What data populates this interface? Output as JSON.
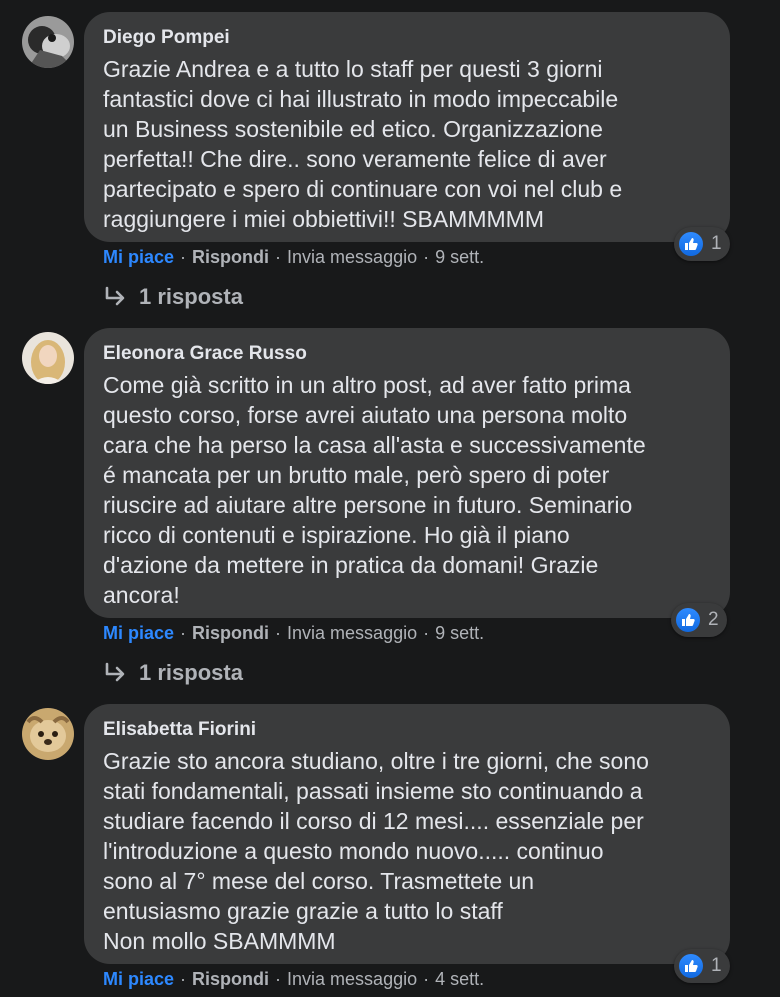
{
  "comments": [
    {
      "author": "Diego Pompei",
      "text": "Grazie Andrea e a tutto lo staff per questi 3 giorni\nfantastici dove ci hai illustrato in modo impeccabile\nun Business sostenibile ed etico. Organizzazione\nperfetta!! Che dire.. sono veramente felice di aver\npartecipato e spero di continuare con voi nel club e\nraggiungere i miei obbiettivi!! SBAMMMMM",
      "reaction_count": "1",
      "actions": {
        "like": "Mi piace",
        "reply": "Rispondi",
        "message": "Invia messaggio",
        "time": "9 sett."
      },
      "replies_label": "1 risposta"
    },
    {
      "author": "Eleonora Grace Russo",
      "text": "Come già scritto in un altro post, ad aver fatto prima\nquesto corso, forse avrei aiutato una persona molto\ncara che ha perso la casa all'asta e successivamente\né mancata per un brutto male, però spero di poter\nriuscire ad aiutare altre persone in futuro. Seminario\nricco di contenuti e ispirazione. Ho già il piano\nd'azione da mettere in pratica da domani! Grazie\nancora!",
      "reaction_count": "2",
      "actions": {
        "like": "Mi piace",
        "reply": "Rispondi",
        "message": "Invia messaggio",
        "time": "9 sett."
      },
      "replies_label": "1 risposta"
    },
    {
      "author": "Elisabetta Fiorini",
      "text": "Grazie sto ancora studiano, oltre i tre giorni, che sono\nstati fondamentali, passati insieme sto continuando a\nstudiare facendo il corso di 12 mesi.... essenziale per\nl'introduzione a questo mondo nuovo..... continuo\nsono al 7° mese del corso. Trasmettete un\nentusiasmo grazie grazie a tutto lo staff\nNon mollo SBAMMMM",
      "reaction_count": "1",
      "actions": {
        "like": "Mi piace",
        "reply": "Rispondi",
        "message": "Invia messaggio",
        "time": "4 sett."
      }
    }
  ],
  "icons": {
    "like": "thumbs-up-icon",
    "reply_arrow": "reply-arrow-icon"
  },
  "colors": {
    "background": "#18191a",
    "bubble": "#3a3b3c",
    "text": "#e4e6eb",
    "secondary": "#b0b3b8",
    "accent": "#2d88ff"
  }
}
